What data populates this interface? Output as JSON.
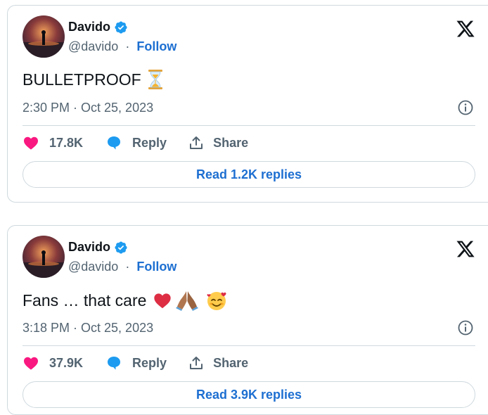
{
  "tweets": [
    {
      "author_name": "Davido",
      "handle": "@davido",
      "separator": "·",
      "follow_label": "Follow",
      "text": "BULLETPROOF",
      "emojis": [
        "hourglass-emoji"
      ],
      "timestamp": "2:30 PM · Oct 25, 2023",
      "likes": "17.8K",
      "reply_label": "Reply",
      "share_label": "Share",
      "read_replies_label": "Read 1.2K replies"
    },
    {
      "author_name": "Davido",
      "handle": "@davido",
      "separator": "·",
      "follow_label": "Follow",
      "text": "Fans … that care",
      "emojis": [
        "red-heart-emoji",
        "folded-hands-emoji",
        "smiling-face-with-hearts-emoji"
      ],
      "timestamp": "3:18 PM · Oct 25, 2023",
      "likes": "37.9K",
      "reply_label": "Reply",
      "share_label": "Share",
      "read_replies_label": "Read 3.9K replies"
    }
  ],
  "colors": {
    "accent": "#1d6fd1",
    "like": "#f91880",
    "verified": "#1d9bf0",
    "muted": "#536471",
    "border": "#cfd9de"
  }
}
